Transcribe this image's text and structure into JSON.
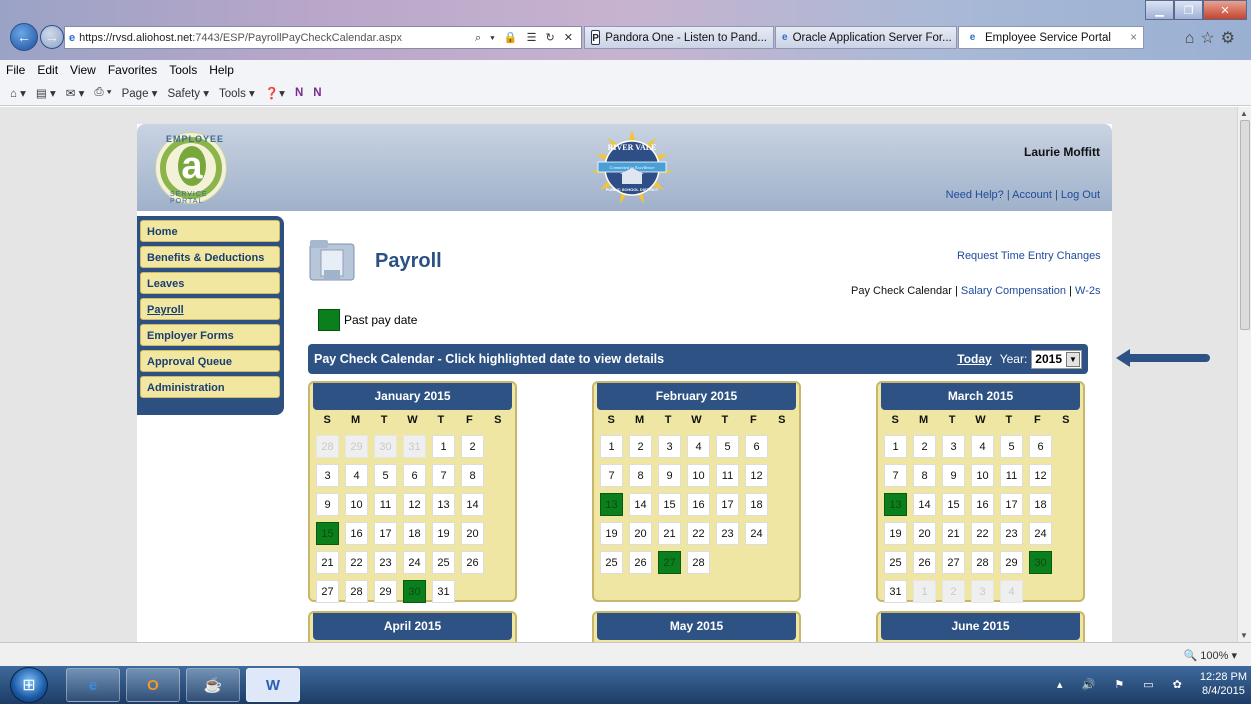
{
  "browser": {
    "url_host": "https://rvsd.aliohost.net",
    "url_rest": ":7443/ESP/PayrollPayCheckCalendar.aspx",
    "address_controls": "⌕ ▾ 🔒 ☰ ↻ ✕",
    "tabs": [
      {
        "label": "Pandora One - Listen to Pand...",
        "icon": "pandora-icon"
      },
      {
        "label": "Oracle Application Server For...",
        "icon": "ie-icon"
      },
      {
        "label": "Employee Service Portal",
        "icon": "ie-icon",
        "close": "×"
      }
    ],
    "menu": [
      "File",
      "Edit",
      "View",
      "Favorites",
      "Tools",
      "Help"
    ],
    "commands": [
      "Page ▾",
      "Safety ▾",
      "Tools ▾"
    ],
    "zoom": "100%"
  },
  "header": {
    "user_name": "Laurie Moffitt",
    "need_help": "Need Help?",
    "account": "Account",
    "logout": "Log Out",
    "sep": "|",
    "logo_top": "EMPLOYEE",
    "logo_letter": "a",
    "logo_bottom": "SERVICE PORTAL",
    "seal_top": "RIVER VALE",
    "seal_ribbon": "Committed to Excellence",
    "seal_bottom": "PUBLIC SCHOOL DISTRICT"
  },
  "nav": {
    "items": [
      "Home",
      "Benefits & Deductions",
      "Leaves",
      "Payroll",
      "Employer Forms",
      "Approval Queue",
      "Administration"
    ]
  },
  "payroll": {
    "title": "Payroll",
    "request_link": "Request Time Entry Changes",
    "sublink_current": "Pay Check Calendar",
    "sublink_salary": "Salary Compensation",
    "sublink_w2": "W-2s",
    "legend": "Past pay date"
  },
  "calendar_bar": {
    "title": "Pay Check Calendar - Click highlighted date to view details",
    "today": "Today",
    "year_label": "Year:",
    "year_value": "2015"
  },
  "dow": [
    "S",
    "M",
    "T",
    "W",
    "T",
    "F",
    "S"
  ],
  "months": [
    {
      "name": "January 2015",
      "lead": [
        "28",
        "29",
        "30",
        "31"
      ],
      "days": 31,
      "pay": [
        15,
        30
      ],
      "trail": []
    },
    {
      "name": "February 2015",
      "lead": [],
      "days": 28,
      "pay": [
        13,
        27
      ],
      "trail": []
    },
    {
      "name": "March 2015",
      "lead": [],
      "days": 31,
      "pay": [
        13,
        30
      ],
      "trail": [
        "1",
        "2",
        "3",
        "4"
      ]
    }
  ],
  "next_months": [
    "April 2015",
    "May 2015",
    "June 2015"
  ],
  "statusbar": {
    "zoom": "100%"
  },
  "taskbar": {
    "time": "12:28 PM",
    "date": "8/4/2015"
  },
  "colors": {
    "portal_blue": "#2d5283",
    "pay_green": "#0b7f1b",
    "nav_yellow": "#f1e7a1"
  }
}
